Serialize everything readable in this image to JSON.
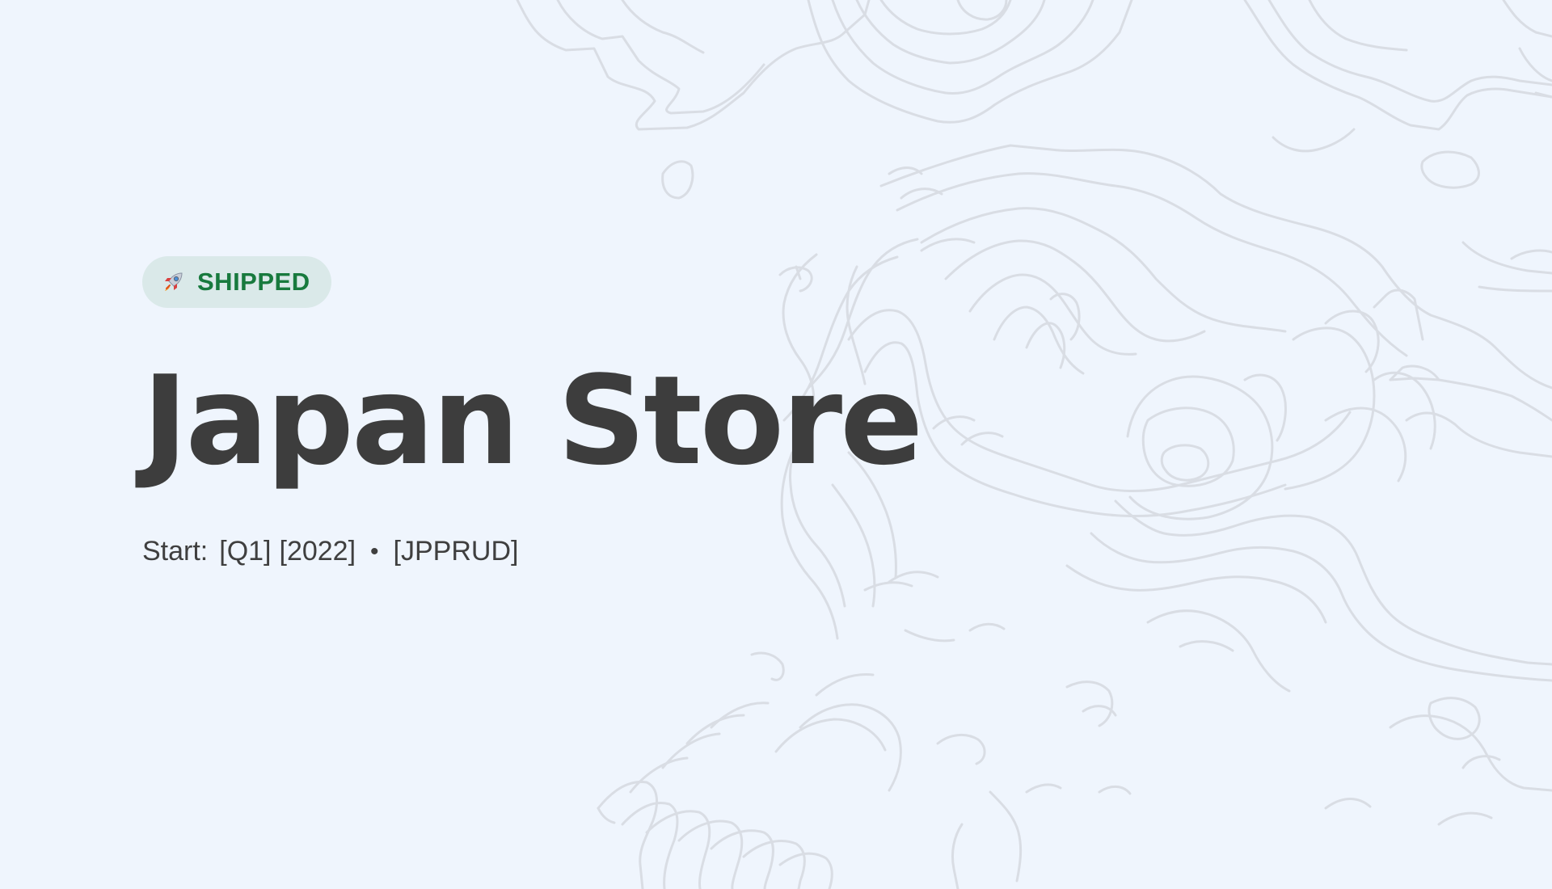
{
  "badge": {
    "icon": "rocket-icon",
    "label": "SHIPPED",
    "color": "#187a3e",
    "background": "#dae9e9"
  },
  "title": "Japan Store",
  "meta": {
    "start_label": "Start:",
    "quarter": "[Q1]",
    "year": "[2022]",
    "separator": "•",
    "code": "[JPPRUD]"
  },
  "background": {
    "color": "#eff5fd",
    "pattern": "topographic-contour-lines",
    "line_color": "#d9dde4"
  }
}
